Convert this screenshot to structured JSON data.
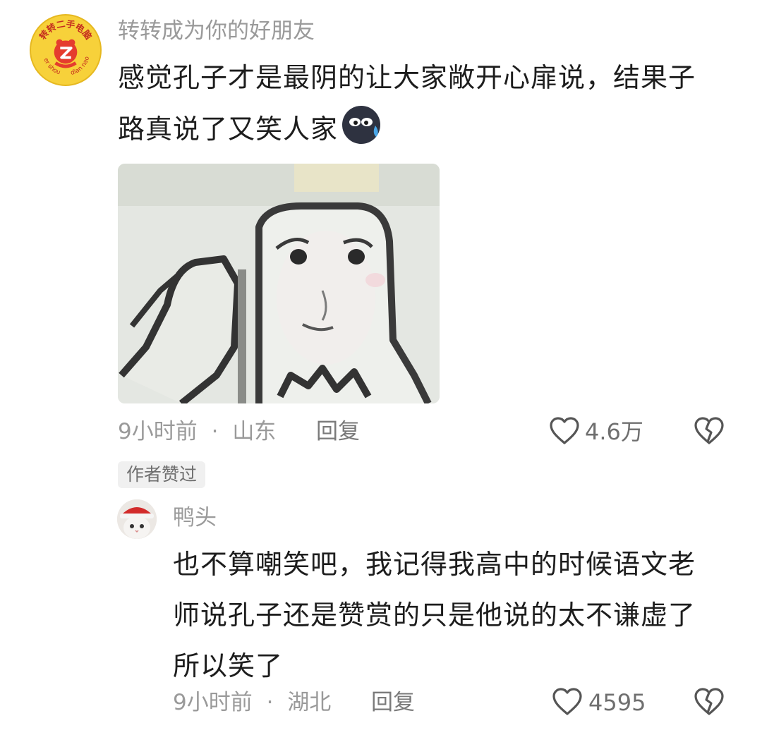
{
  "comment1": {
    "username": "转转成为你的好朋友",
    "avatar_icon": "zhuanzhuan-logo-avatar",
    "avatar_text": {
      "top": "转转二手电脑",
      "left": "er shou",
      "right": "dian nao"
    },
    "line1": "感觉孔子才是最阴的让大家敞开心扉说，结果子",
    "line2": "路真说了又笑人家",
    "emoji": "sweat-face-emoji",
    "image": "confucius-meme-image",
    "time": "9小时前",
    "separator": "·",
    "location": "山东",
    "reply": "回复",
    "likes": "4.6万",
    "badge": "作者赞过"
  },
  "comment2": {
    "username": "鸭头",
    "avatar_icon": "cat-santa-hat-avatar",
    "line1": "也不算嘲笑吧，我记得我高中的时候语文老",
    "line2": "师说孔子还是赞赏的只是他说的太不谦虚了",
    "line3": "所以笑了",
    "time": "9小时前",
    "separator": "·",
    "location": "湖北",
    "reply": "回复",
    "likes": "4595"
  },
  "colors": {
    "background": "#ffffff",
    "text": "#1d1d1d",
    "muted": "#9a9a9a",
    "avatar_yellow": "#f7d13a",
    "avatar_red": "#e53c2e"
  }
}
